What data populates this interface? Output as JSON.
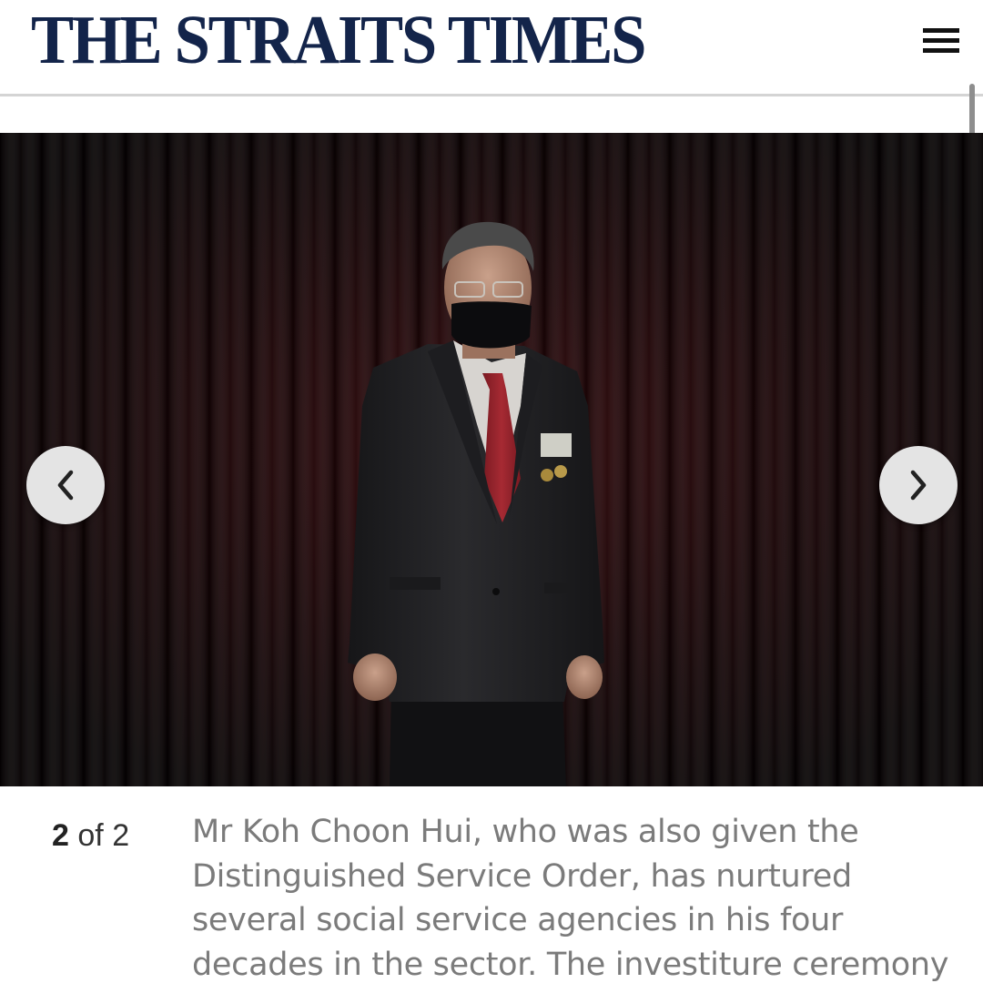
{
  "header": {
    "masthead": "THE STRAITS TIMES",
    "menu_icon": "hamburger-menu-icon"
  },
  "gallery": {
    "prev_icon": "chevron-left-icon",
    "next_icon": "chevron-right-icon",
    "current": "2",
    "of_label": "of",
    "total": "2",
    "caption": "Mr Koh Choon Hui, who was also given the Distinguished Service Order, has nurtured several social service agencies in his four decades in the sector. The investiture ceremony"
  },
  "colors": {
    "masthead": "#13244a",
    "caption_text": "#7b7b7b",
    "curtain": "#2a0709"
  }
}
